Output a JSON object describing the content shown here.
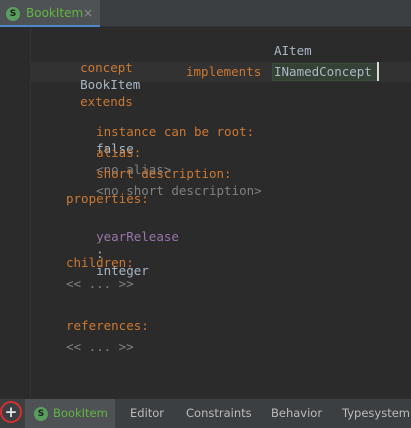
{
  "file_tab": {
    "badge": "S",
    "label": "BookItem",
    "close": "×"
  },
  "editor": {
    "kw_concept": "concept",
    "concept_name": "BookItem",
    "kw_extends": "extends",
    "extends_value": "AItem",
    "kw_implements": "implements",
    "implements_value": "INamedConcept",
    "label_root": "instance can be root:",
    "value_root": "false",
    "label_alias": "alias:",
    "value_alias": "<no alias>",
    "label_short": "short description:",
    "value_short": "<no short description>",
    "label_properties": "properties:",
    "property_name": "yearRelease",
    "property_colon": ":",
    "property_type": "integer",
    "label_children": "children:",
    "children_placeholder": "<< ... >>",
    "label_references": "references:",
    "references_placeholder": "<< ... >>"
  },
  "bottom_bar": {
    "add_icon": "+",
    "tabs": [
      {
        "badge": "S",
        "label": "BookItem"
      },
      {
        "label": "Editor"
      },
      {
        "label": "Constraints"
      },
      {
        "label": "Behavior"
      },
      {
        "label": "Typesystem"
      }
    ]
  },
  "colors": {
    "keyword": "#cc7832",
    "text": "#a9b7c6",
    "placeholder": "#808080",
    "property": "#9876aa",
    "active_tab": "#62b543"
  }
}
